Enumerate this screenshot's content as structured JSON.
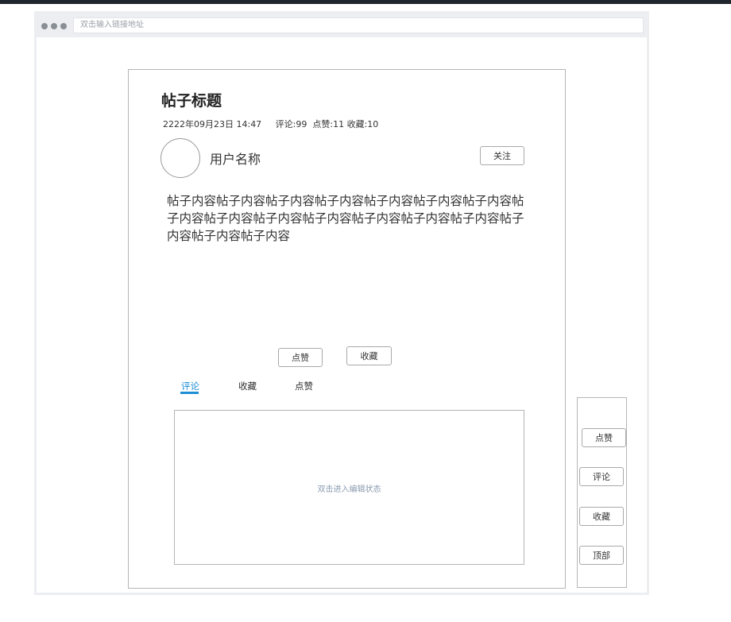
{
  "browser": {
    "url_placeholder": "双击输入链接地址"
  },
  "post": {
    "title": "帖子标题",
    "date": "2222年09月23日 14:47",
    "stats": "评论:99  点赞:11 收藏:10",
    "username": "用户名称",
    "follow_label": "关注",
    "content": "帖子内容帖子内容帖子内容帖子内容帖子内容帖子内容帖子内容帖子内容帖子内容帖子内容帖子内容帖子内容帖子内容帖子内容帖子内容帖子内容帖子内容",
    "like_label": "点赞",
    "favorite_label": "收藏"
  },
  "tabs": [
    {
      "label": "评论",
      "active": true
    },
    {
      "label": "收藏",
      "active": false
    },
    {
      "label": "点赞",
      "active": false
    }
  ],
  "editor": {
    "hint": "双击进入编辑状态"
  },
  "sidebar": {
    "items": [
      {
        "label": "点赞"
      },
      {
        "label": "评论"
      },
      {
        "label": "收藏"
      },
      {
        "label": "顶部"
      }
    ]
  },
  "colors": {
    "accent": "#1e8fd6",
    "border": "#b5b5b5",
    "topbar": "#1f262e"
  }
}
